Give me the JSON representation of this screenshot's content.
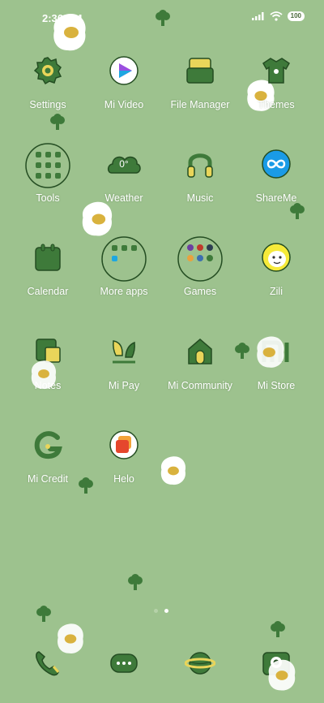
{
  "status_bar": {
    "time": "2:36 AM",
    "battery": "100"
  },
  "apps": [
    {
      "name": "settings",
      "label": "Settings"
    },
    {
      "name": "mi-video",
      "label": "Mi Video"
    },
    {
      "name": "file-manager",
      "label": "File Manager"
    },
    {
      "name": "themes",
      "label": "Themes"
    },
    {
      "name": "tools",
      "label": "Tools"
    },
    {
      "name": "weather",
      "label": "Weather",
      "temp": "0°"
    },
    {
      "name": "music",
      "label": "Music"
    },
    {
      "name": "shareme",
      "label": "ShareMe"
    },
    {
      "name": "calendar",
      "label": "Calendar"
    },
    {
      "name": "more-apps",
      "label": "More apps"
    },
    {
      "name": "games",
      "label": "Games"
    },
    {
      "name": "zili",
      "label": "Zili"
    },
    {
      "name": "notes",
      "label": "Notes"
    },
    {
      "name": "mi-pay",
      "label": "Mi Pay"
    },
    {
      "name": "mi-community",
      "label": "Mi Community"
    },
    {
      "name": "mi-store",
      "label": "Mi Store"
    },
    {
      "name": "mi-credit",
      "label": "Mi Credit"
    },
    {
      "name": "helo",
      "label": "Helo"
    }
  ],
  "page_indicator": {
    "count": 2,
    "active": 2
  },
  "dock": [
    "phone-icon",
    "messages-icon",
    "browser-icon",
    "camera-icon"
  ],
  "colors": {
    "background": "#9dc28e",
    "icon_dark": "#3e7a3a",
    "icon_accent": "#e9d55a",
    "egg_yolk": "#d9b23e"
  }
}
